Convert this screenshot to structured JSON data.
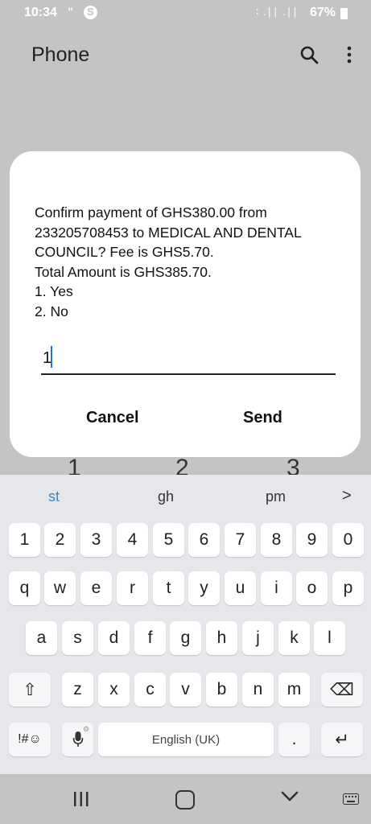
{
  "status_bar": {
    "time": "10:34",
    "quote_glyph": "”",
    "signal_glyphs": "∶ .∣∣ .∣∣",
    "battery": "67%"
  },
  "app": {
    "title": "Phone"
  },
  "dialog": {
    "message": "Confirm payment of GHS380.00 from 233205708453 to MEDICAL AND DENTAL COUNCIL? Fee is GHS5.70.\nTotal Amount is GHS385.70.\n1. Yes\n2. No",
    "input_value": "1",
    "cancel_label": "Cancel",
    "send_label": "Send"
  },
  "dialpad_peek": [
    "1",
    "2",
    "3"
  ],
  "keyboard": {
    "suggestions": [
      "st",
      "gh",
      "pm"
    ],
    "more_arrow": ">",
    "numbers": [
      "1",
      "2",
      "3",
      "4",
      "5",
      "6",
      "7",
      "8",
      "9",
      "0"
    ],
    "row1": [
      "q",
      "w",
      "e",
      "r",
      "t",
      "y",
      "u",
      "i",
      "o",
      "p"
    ],
    "row2": [
      "a",
      "s",
      "d",
      "f",
      "g",
      "h",
      "j",
      "k",
      "l"
    ],
    "row3": [
      "z",
      "x",
      "c",
      "v",
      "b",
      "n",
      "m"
    ],
    "symbols_label": "!#☺",
    "space_label": "English (UK)",
    "period_label": ".",
    "shift_glyph": "⇧",
    "backspace_glyph": "⌫",
    "enter_glyph": "↵",
    "mic_gear_glyph": "⚙"
  },
  "colors": {
    "accent": "#2a8ad4",
    "background": "#c4c4c4",
    "keyboard_bg": "#e6e7ea"
  }
}
